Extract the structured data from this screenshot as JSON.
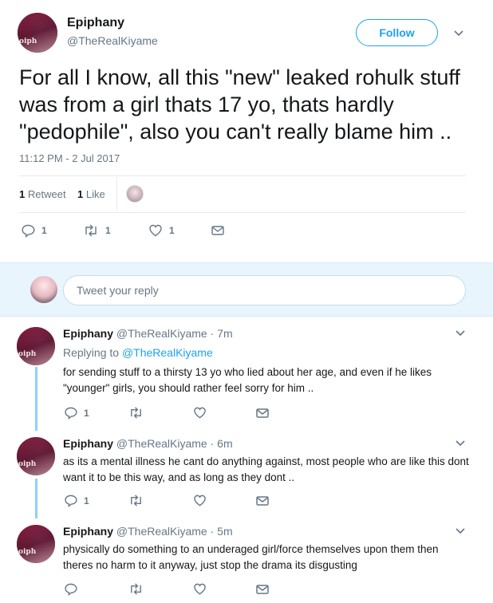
{
  "tweet": {
    "author_name": "Epiphany",
    "author_handle": "@TheRealKiyame",
    "avatar_text": "oiph",
    "follow_label": "Follow",
    "text": "For all I know, all this \"new\" leaked rohulk stuff was from a girl thats 17 yo, thats hardly \"pedophile\", also you can't really blame him ..",
    "timestamp": "11:12 PM - 2 Jul 2017",
    "retweets_count": "1",
    "retweets_label": "Retweet",
    "likes_count": "1",
    "likes_label": "Like",
    "actions": {
      "reply_count": "1",
      "retweet_count": "1",
      "like_count": "1"
    }
  },
  "reply_box": {
    "placeholder": "Tweet your reply"
  },
  "replies": [
    {
      "name": "Epiphany",
      "handle": "@TheRealKiyame",
      "time": "· 7m",
      "replying_prefix": "Replying to ",
      "replying_to": "@TheRealKiyame",
      "text": "for sending stuff to a thirsty 13 yo who lied about her age, and even if he likes \"younger\" girls, you should rather feel sorry for him ..",
      "reply_count": "1"
    },
    {
      "name": "Epiphany",
      "handle": "@TheRealKiyame",
      "time": "· 6m",
      "text": "as its a mental illness he cant do anything against, most people who are like this dont want it to be this way, and as long as they dont ..",
      "reply_count": "1"
    },
    {
      "name": "Epiphany",
      "handle": "@TheRealKiyame",
      "time": "· 5m",
      "text": "physically do something to an underaged girl/force themselves upon them then theres no harm to it anyway, just stop the drama its disgusting"
    }
  ],
  "colors": {
    "accent": "#1da1f2",
    "muted": "#657786",
    "thread": "#8ed0f9",
    "reply_bg": "#e8f5fd"
  }
}
